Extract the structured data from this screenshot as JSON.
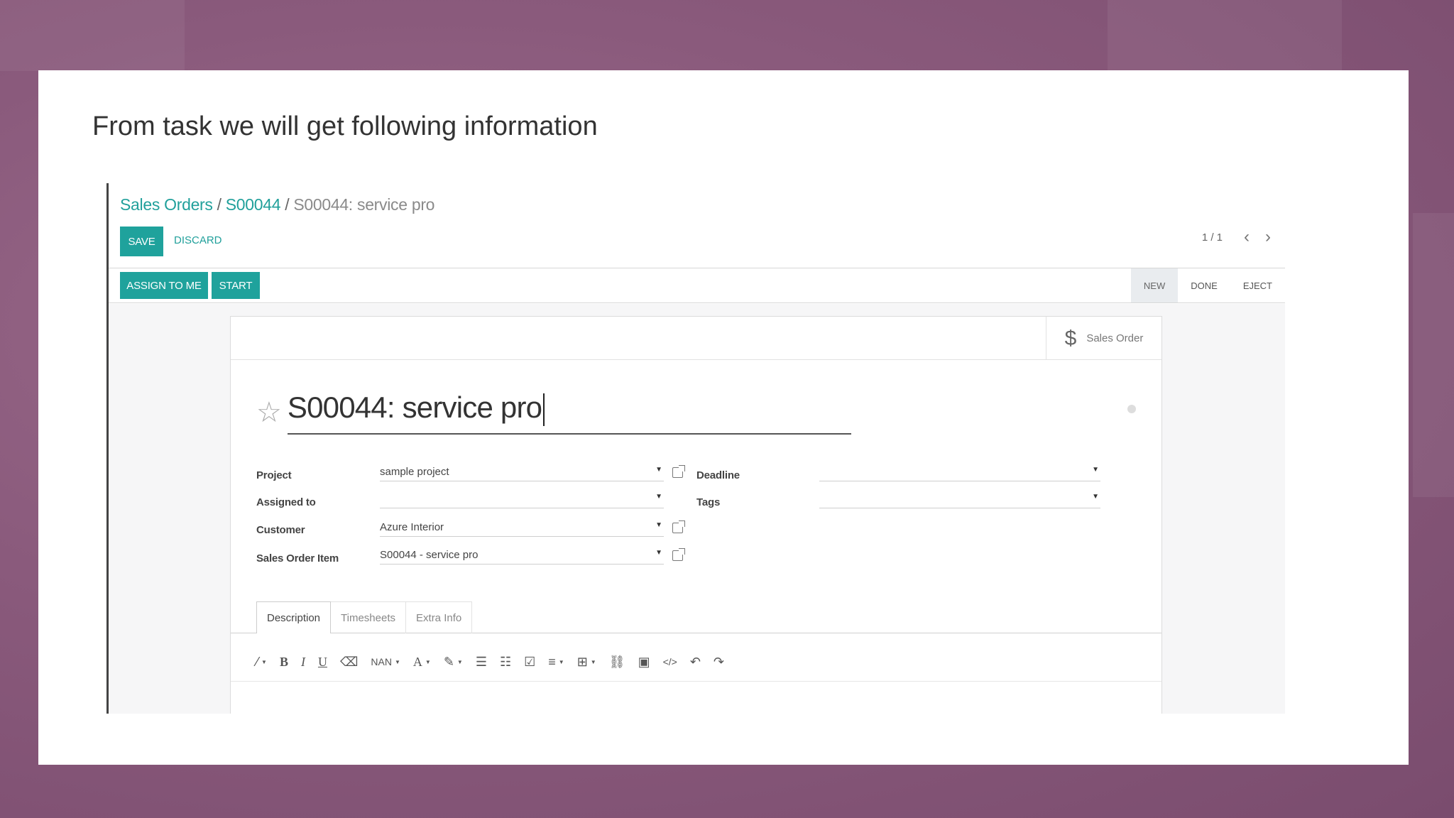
{
  "slide": {
    "title": "From task we will get following information"
  },
  "breadcrumb": {
    "item1": "Sales Orders",
    "sep": "/",
    "item2": "S00044",
    "current": "S00044: service pro"
  },
  "buttons": {
    "save": "SAVE",
    "discard": "DISCARD",
    "assign": "ASSIGN TO ME",
    "start": "START"
  },
  "pager": {
    "text": "1 / 1"
  },
  "stages": [
    "NEW",
    "DONE",
    "EJECT"
  ],
  "smart_button": {
    "label": "Sales Order"
  },
  "record": {
    "title": "S00044: service pro"
  },
  "fields": {
    "project_label": "Project",
    "project_value": "sample project",
    "assigned_label": "Assigned to",
    "assigned_value": "",
    "customer_label": "Customer",
    "customer_value": "Azure Interior",
    "soi_label": "Sales Order Item",
    "soi_value": "S00044 - service pro",
    "deadline_label": "Deadline",
    "deadline_value": "",
    "tags_label": "Tags",
    "tags_value": ""
  },
  "tabs": [
    "Description",
    "Timesheets",
    "Extra Info"
  ],
  "editor": {
    "font_size": "NAN"
  }
}
